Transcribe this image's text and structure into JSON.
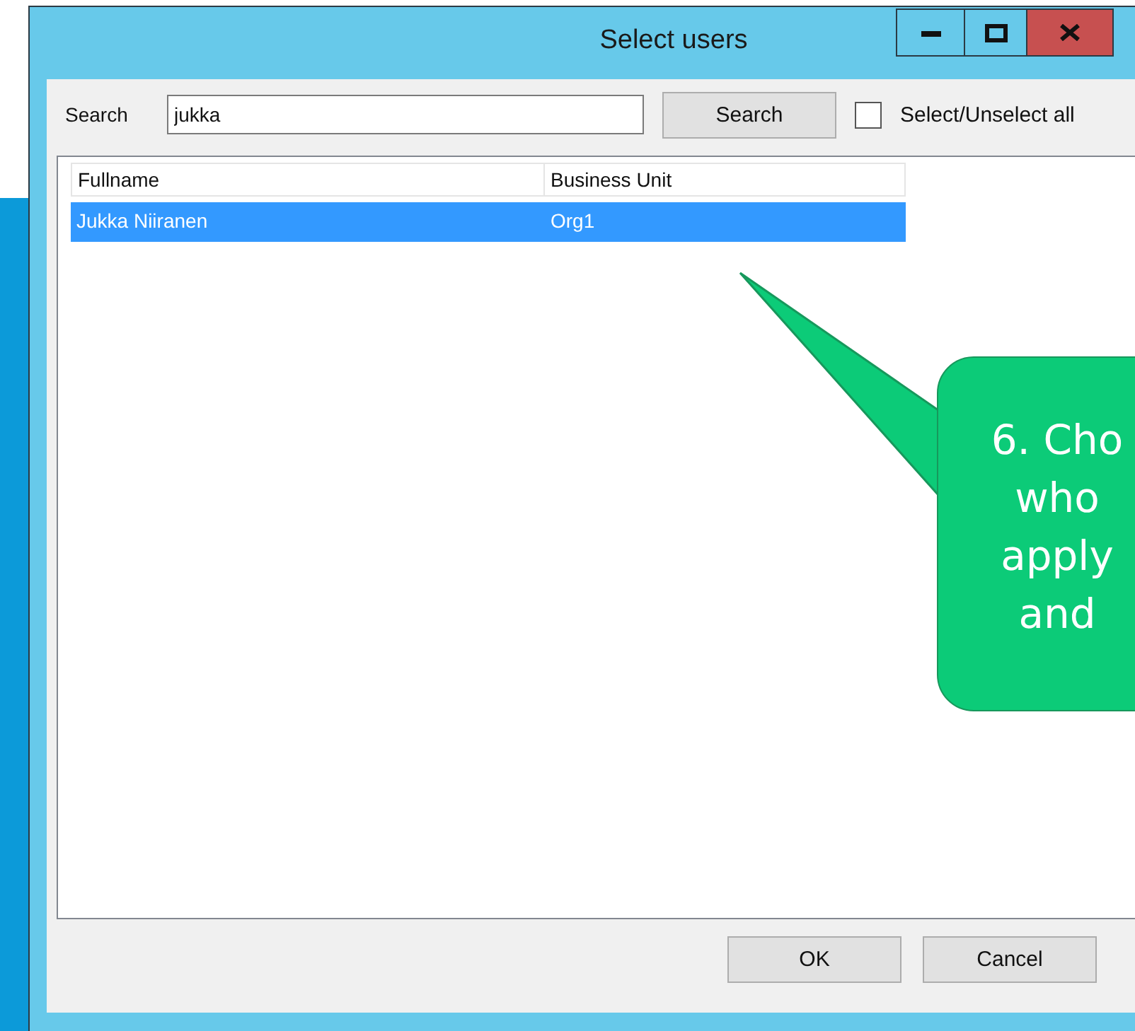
{
  "window": {
    "title": "Select users"
  },
  "search": {
    "label": "Search",
    "value": "jukka",
    "button": "Search"
  },
  "select_all": {
    "label": "Select/Unselect all",
    "checked": false
  },
  "table": {
    "columns": [
      "Fullname",
      "Business Unit"
    ],
    "rows": [
      {
        "cells": [
          "Jukka Niiranen",
          "Org1"
        ],
        "selected": true
      }
    ]
  },
  "buttons": [
    "OK",
    "Cancel"
  ],
  "callout": {
    "lines": [
      "6. Cho",
      "who",
      "apply",
      "and"
    ]
  }
}
